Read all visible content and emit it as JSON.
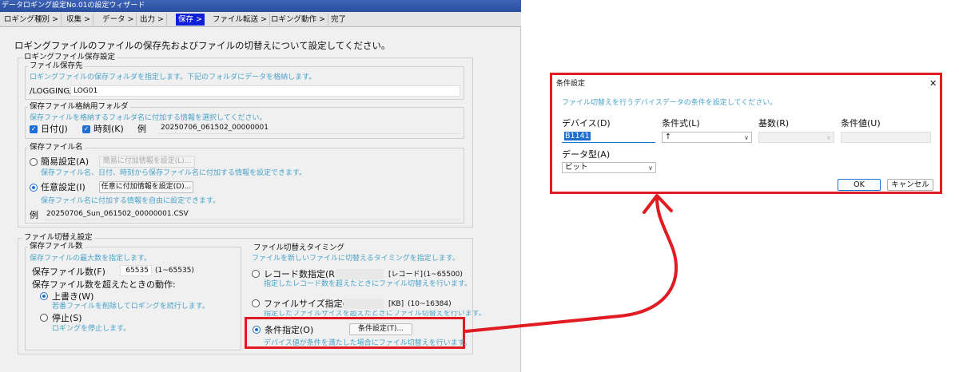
{
  "wizard": {
    "title": "データロギング設定No.01の設定ウィザード",
    "steps": [
      "ロギング種別 >",
      "収集 >",
      "データ >",
      "出力 >",
      "保存 >",
      "ファイル転送 >",
      "ロギング動作 >",
      "完了"
    ],
    "active_step": 4,
    "heading": "ロギングファイルのファイルの保存先およびファイルの切替えについて設定してください。",
    "save_settings": {
      "group_title": "ロギングファイル保存設定",
      "dest_title": "ファイル保存先",
      "dest_hint": "ロギングファイルの保存フォルダを指定します。下記のフォルダにデータを格納します。",
      "dest_prefix": "/LOGGING/",
      "dest_value": "LOG01",
      "folder_title": "保存ファイル格納用フォルダ",
      "folder_hint": "保存ファイルを格納するフォルダ名に付加する情報を選択してください。",
      "date_label": "日付(J)",
      "time_label": "時刻(K)",
      "example_label": "例",
      "folder_example": "20250706_061502_00000001",
      "name_title": "保存ファイル名",
      "simple_label": "簡易設定(A)",
      "simple_button": "簡易に付加情報を設定(L)...",
      "simple_hint": "保存ファイル名、日付、時刻から保存ファイル名に付加する情報を設定できます。",
      "custom_label": "任意設定(I)",
      "custom_button": "任意に付加情報を設定(D)...",
      "custom_hint": "保存ファイル名に付加する情報を自由に設定できます。",
      "name_example": "20250706_Sun_061502_00000001.CSV"
    },
    "switch_settings": {
      "group_title": "ファイル切替え設定",
      "count_title": "保存ファイル数",
      "count_hint": "保存ファイルの最大数を指定します。",
      "count_label": "保存ファイル数(F)",
      "count_value": "65535",
      "count_range": "(1~65535)",
      "over_label": "保存ファイル数を超えたときの動作:",
      "overwrite_label": "上書き(W)",
      "overwrite_hint": "若番ファイルを削除してロギングを続行します。",
      "stop_label": "停止(S)",
      "stop_hint": "ロギングを停止します。",
      "timing_title": "ファイル切替えタイミング",
      "timing_hint": "ファイルを新しいファイルに切替えるタイミングを指定します。",
      "record_label": "レコード数指定(R)",
      "record_unit": "[レコード]",
      "record_range": "(1~65500)",
      "record_hint": "指定したレコード数を超えたときにファイル切替えを行います。",
      "size_label": "ファイルサイズ指定(Z)",
      "size_unit": "[KB]",
      "size_range": "(10~16384)",
      "size_hint": "指定したファイルサイズを超えたときにファイル切替えを行います。",
      "cond_label": "条件指定(O)",
      "cond_button": "条件設定(T)...",
      "cond_hint": "デバイス値が条件を満たした場合にファイル切替えを行います。"
    }
  },
  "dialog": {
    "title": "条件設定",
    "close_glyph": "✕",
    "description": "ファイル切替えを行うデバイスデータの条件を設定してください。",
    "device_label": "デバイス(D)",
    "device_value": "B1141",
    "expr_label": "条件式(L)",
    "expr_value": "↑",
    "radix_label": "基数(R)",
    "radix_value": "",
    "cond_value_label": "条件値(U)",
    "cond_value": "",
    "datatype_label": "データ型(A)",
    "datatype_value": "ビット",
    "ok_label": "OK",
    "cancel_label": "キャンセル"
  },
  "colors": {
    "highlight": "#e11b22",
    "active_step": "#1020d8",
    "accent": "#1e6fd0",
    "hint": "#4aa3c9"
  }
}
